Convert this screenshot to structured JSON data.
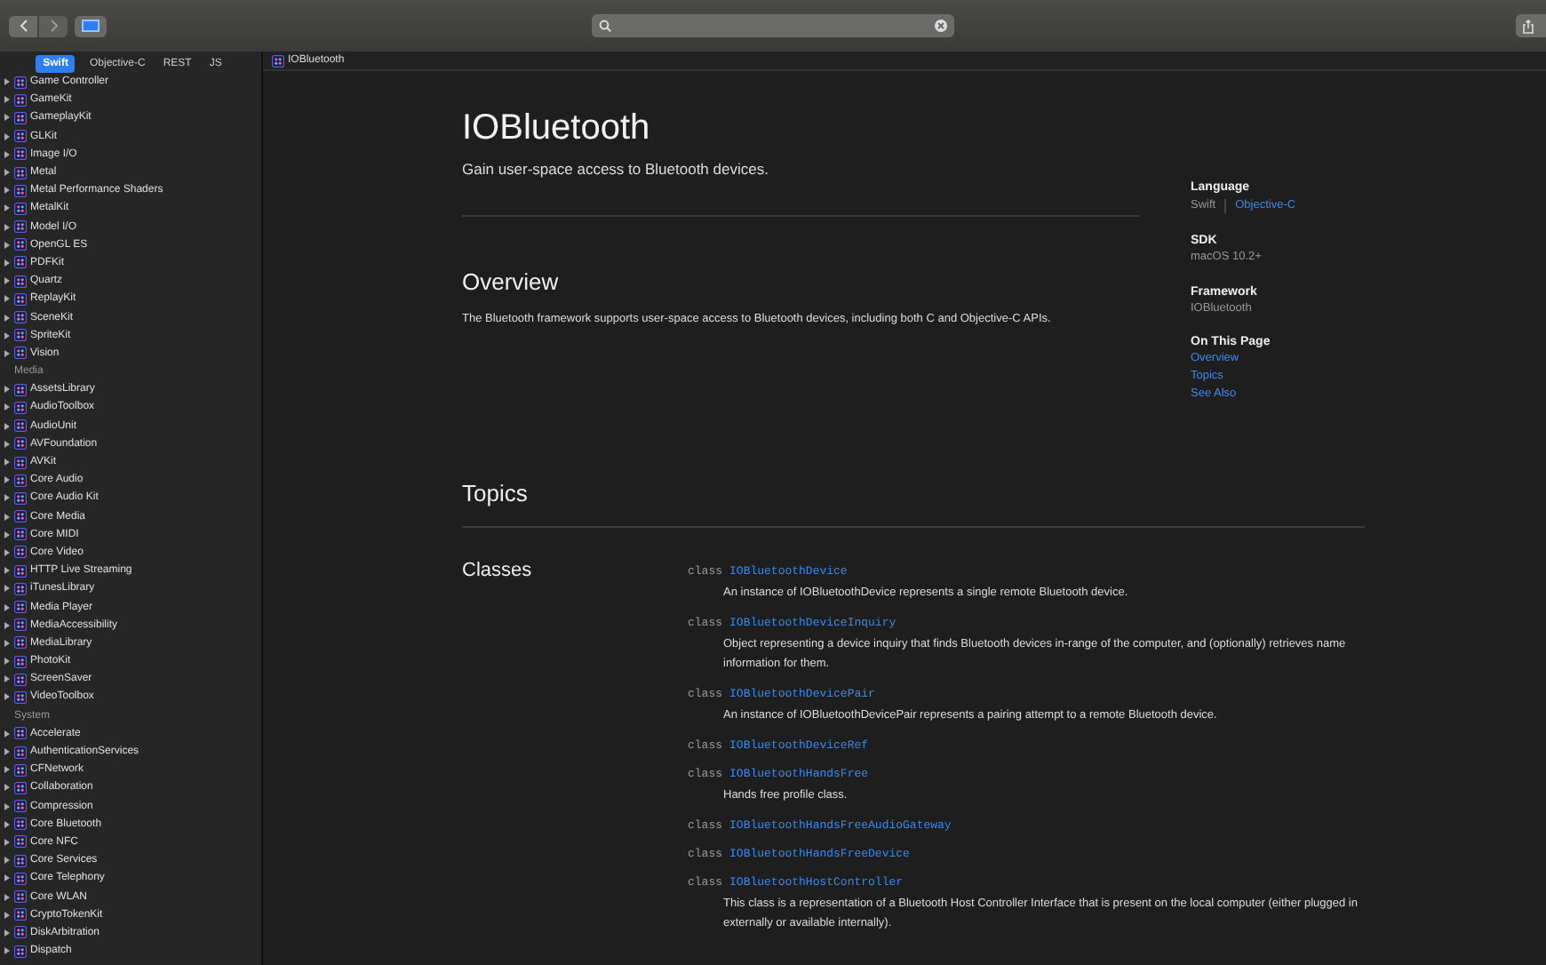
{
  "language_tabs": [
    {
      "label": "Swift",
      "selected": true
    },
    {
      "label": "Objective-C",
      "selected": false
    },
    {
      "label": "REST",
      "selected": false
    },
    {
      "label": "JS",
      "selected": false
    }
  ],
  "breadcrumb": "IOBluetooth",
  "sidebar": {
    "items": [
      {
        "kind": "framework",
        "label": "Game Controller",
        "expanded": false
      },
      {
        "kind": "framework",
        "label": "GameKit",
        "expanded": false
      },
      {
        "kind": "framework",
        "label": "GameplayKit",
        "expanded": false
      },
      {
        "kind": "framework",
        "label": "GLKit",
        "expanded": false
      },
      {
        "kind": "framework",
        "label": "Image I/O",
        "expanded": false
      },
      {
        "kind": "framework",
        "label": "Metal",
        "expanded": false
      },
      {
        "kind": "framework",
        "label": "Metal Performance Shaders",
        "expanded": false
      },
      {
        "kind": "framework",
        "label": "MetalKit",
        "expanded": false
      },
      {
        "kind": "framework",
        "label": "Model I/O",
        "expanded": false
      },
      {
        "kind": "framework",
        "label": "OpenGL ES",
        "expanded": false
      },
      {
        "kind": "framework",
        "label": "PDFKit",
        "expanded": false
      },
      {
        "kind": "framework",
        "label": "Quartz",
        "expanded": false
      },
      {
        "kind": "framework",
        "label": "ReplayKit",
        "expanded": false
      },
      {
        "kind": "framework",
        "label": "SceneKit",
        "expanded": false
      },
      {
        "kind": "framework",
        "label": "SpriteKit",
        "expanded": false
      },
      {
        "kind": "framework",
        "label": "Vision",
        "expanded": false
      },
      {
        "kind": "heading",
        "label": "Media"
      },
      {
        "kind": "framework",
        "label": "AssetsLibrary",
        "expanded": false
      },
      {
        "kind": "framework",
        "label": "AudioToolbox",
        "expanded": false
      },
      {
        "kind": "framework",
        "label": "AudioUnit",
        "expanded": false
      },
      {
        "kind": "framework",
        "label": "AVFoundation",
        "expanded": false
      },
      {
        "kind": "framework",
        "label": "AVKit",
        "expanded": false
      },
      {
        "kind": "framework",
        "label": "Core Audio",
        "expanded": false
      },
      {
        "kind": "framework",
        "label": "Core Audio Kit",
        "expanded": false
      },
      {
        "kind": "framework",
        "label": "Core Media",
        "expanded": false
      },
      {
        "kind": "framework",
        "label": "Core MIDI",
        "expanded": false
      },
      {
        "kind": "framework",
        "label": "Core Video",
        "expanded": false
      },
      {
        "kind": "framework",
        "label": "HTTP Live Streaming",
        "expanded": false
      },
      {
        "kind": "framework",
        "label": "iTunesLibrary",
        "expanded": false
      },
      {
        "kind": "framework",
        "label": "Media Player",
        "expanded": false
      },
      {
        "kind": "framework",
        "label": "MediaAccessibility",
        "expanded": false
      },
      {
        "kind": "framework",
        "label": "MediaLibrary",
        "expanded": false
      },
      {
        "kind": "framework",
        "label": "PhotoKit",
        "expanded": false
      },
      {
        "kind": "framework",
        "label": "ScreenSaver",
        "expanded": false
      },
      {
        "kind": "framework",
        "label": "VideoToolbox",
        "expanded": false
      },
      {
        "kind": "heading",
        "label": "System"
      },
      {
        "kind": "framework",
        "label": "Accelerate",
        "expanded": false
      },
      {
        "kind": "framework",
        "label": "AuthenticationServices",
        "expanded": false
      },
      {
        "kind": "framework",
        "label": "CFNetwork",
        "expanded": false
      },
      {
        "kind": "framework",
        "label": "Collaboration",
        "expanded": false
      },
      {
        "kind": "framework",
        "label": "Compression",
        "expanded": false
      },
      {
        "kind": "framework",
        "label": "Core Bluetooth",
        "expanded": false
      },
      {
        "kind": "framework",
        "label": "Core NFC",
        "expanded": false
      },
      {
        "kind": "framework",
        "label": "Core Services",
        "expanded": false
      },
      {
        "kind": "framework",
        "label": "Core Telephony",
        "expanded": false
      },
      {
        "kind": "framework",
        "label": "Core WLAN",
        "expanded": false
      },
      {
        "kind": "framework",
        "label": "CryptoTokenKit",
        "expanded": false
      },
      {
        "kind": "framework",
        "label": "DiskArbitration",
        "expanded": false
      },
      {
        "kind": "framework",
        "label": "Dispatch",
        "expanded": false
      }
    ]
  },
  "page": {
    "title": "IOBluetooth",
    "abstract": "Gain user-space access to Bluetooth devices.",
    "overview": {
      "heading": "Overview",
      "text": "The Bluetooth framework supports user-space access to Bluetooth devices, including both C and Objective-C APIs."
    },
    "topics": {
      "heading": "Topics",
      "groups": [
        {
          "heading": "Classes",
          "items": [
            {
              "keyword": "class",
              "name": "IOBluetoothDevice",
              "description": "An instance of IOBluetoothDevice represents a single remote Bluetooth device."
            },
            {
              "keyword": "class",
              "name": "IOBluetoothDeviceInquiry",
              "description": "Object representing a device inquiry that finds Bluetooth devices in-range of the computer, and (optionally) retrieves name information for them."
            },
            {
              "keyword": "class",
              "name": "IOBluetoothDevicePair",
              "description": "An instance of IOBluetoothDevicePair represents a pairing attempt to a remote Bluetooth device."
            },
            {
              "keyword": "class",
              "name": "IOBluetoothDeviceRef"
            },
            {
              "keyword": "class",
              "name": "IOBluetoothHandsFree",
              "description": "Hands free profile class."
            },
            {
              "keyword": "class",
              "name": "IOBluetoothHandsFreeAudioGateway"
            },
            {
              "keyword": "class",
              "name": "IOBluetoothHandsFreeDevice"
            },
            {
              "keyword": "class",
              "name": "IOBluetoothHostController",
              "description": "This class is a representation of a Bluetooth Host Controller Interface that is present on the local computer (either plugged in externally or available internally)."
            }
          ]
        }
      ]
    }
  },
  "summary": {
    "language": {
      "heading": "Language",
      "options": [
        {
          "label": "Swift",
          "selected": true
        },
        {
          "label": "Objective-C",
          "selected": false
        }
      ]
    },
    "sdk": {
      "heading": "SDK",
      "value": "macOS 10.2+"
    },
    "framework": {
      "heading": "Framework",
      "value": "IOBluetooth"
    },
    "on_this_page": {
      "heading": "On This Page",
      "links": [
        "Overview",
        "Topics",
        "See Also"
      ]
    }
  }
}
